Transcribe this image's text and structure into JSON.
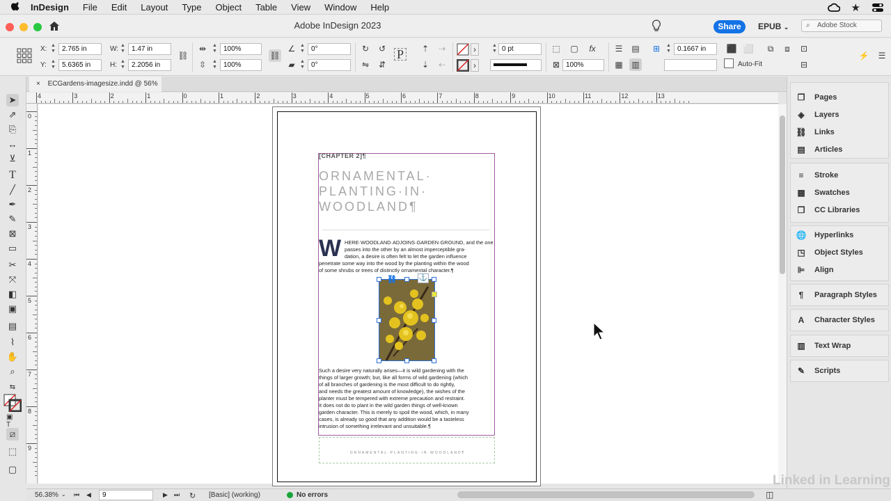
{
  "menubar": {
    "items": [
      "InDesign",
      "File",
      "Edit",
      "Layout",
      "Type",
      "Object",
      "Table",
      "View",
      "Window",
      "Help"
    ]
  },
  "titlebar": {
    "title": "Adobe InDesign 2023",
    "share_label": "Share",
    "epub_label": "EPUB",
    "stock_placeholder": "Adobe Stock"
  },
  "control": {
    "x_label": "X:",
    "x_value": "2.765 in",
    "y_label": "Y:",
    "y_value": "5.6365 in",
    "w_label": "W:",
    "w_value": "1.47 in",
    "h_label": "H:",
    "h_value": "2.2056 in",
    "scale_x": "100%",
    "scale_y": "100%",
    "rotate": "0°",
    "shear": "0°",
    "stroke_weight": "0 pt",
    "opacity": "100%",
    "gutter": "0.1667 in",
    "autofit_label": "Auto-Fit"
  },
  "tab": {
    "close": "×",
    "label": "ECGardens-imagesize.indd @ 56%"
  },
  "ruler": {
    "h_ticks": [
      "4",
      "3",
      "2",
      "1",
      "0",
      "1",
      "2",
      "3",
      "4",
      "5",
      "6",
      "7",
      "8",
      "9",
      "10",
      "11",
      "12",
      "13"
    ],
    "v_ticks": [
      "0",
      "1",
      "2",
      "3",
      "4",
      "5",
      "6",
      "7",
      "8",
      "9"
    ]
  },
  "document": {
    "chapter": "[CHAPTER 2]¶",
    "headline_lines": [
      "ORNAMENTAL·",
      "PLANTING·IN·",
      "WOODLAND¶"
    ],
    "dropcap": "W",
    "para1_lines": [
      "HERE·WOODLAND·ADJOINS·GARDEN·GROUND, and the one",
      "passes into the other by an almost imperceptible gra-",
      "dation, a desire is often felt to let the garden influence",
      "penetrate some way into the wood by the planting within the wood",
      "of some shrubs or trees of distinctly ornamental character.¶"
    ],
    "para2_lines": [
      "Such a desire very naturally arises—it is wild gardening with the",
      "things of larger growth; but, like all forms of wild gardening (which",
      "of all branches of gardening is the most difficult to do rightly,",
      "and needs the greatest amount of knowledge), the wishes of the",
      "planter must be tempered with extreme precaution and restraint.",
      "It does not do to plant in the wild garden things of well-known",
      "garden character. This is merely to spoil the wood, which, in many",
      "cases, is already so good that any addition would be a tasteless",
      "intrusion of something irrelevant and unsuitable.¶"
    ],
    "footer_text": "ORNAMENTAL·PLANTING·IN·WOODLAND¶"
  },
  "panels": {
    "group1": [
      "Pages",
      "Layers",
      "Links",
      "Articles"
    ],
    "group2": [
      "Stroke",
      "Swatches",
      "CC Libraries"
    ],
    "group3": [
      "Hyperlinks",
      "Object Styles",
      "Align"
    ],
    "group4": [
      "Paragraph Styles"
    ],
    "group5": [
      "Character Styles"
    ],
    "group6": [
      "Text Wrap"
    ],
    "group7": [
      "Scripts"
    ]
  },
  "status": {
    "zoom": "56.38%",
    "page": "9",
    "style": "[Basic] (working)",
    "errors": "No errors"
  },
  "watermark": "Linked in Learning",
  "colors": {
    "accent": "#1473e6",
    "frame": "#a05aa0",
    "ok": "#1aa53a"
  }
}
